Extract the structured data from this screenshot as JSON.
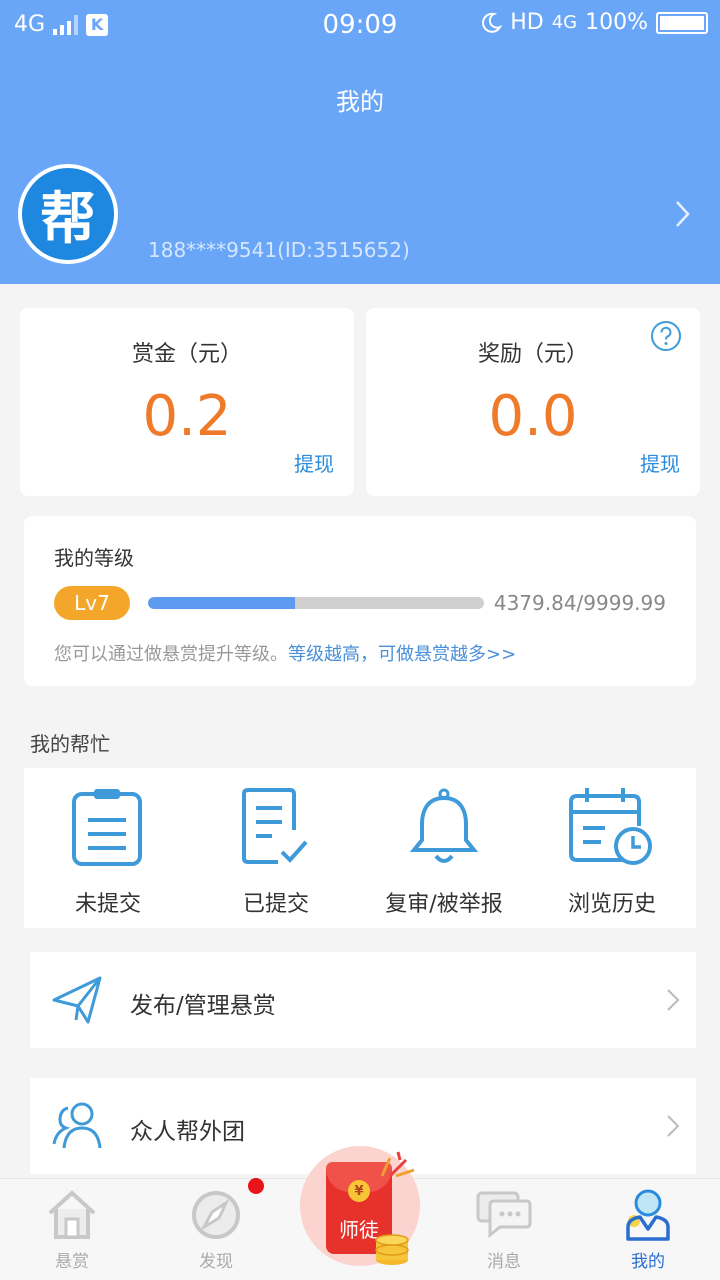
{
  "status_bar": {
    "network": "4G",
    "time": "09:09",
    "hd": "HD",
    "network_right": "4G",
    "battery": "100%"
  },
  "header": {
    "title": "我的",
    "avatar_text": "帮",
    "user_id": "188****9541(ID:3515652)"
  },
  "balance_cards": [
    {
      "title": "赏金（元）",
      "value": "0.2",
      "action": "提现"
    },
    {
      "title": "奖励（元）",
      "value": "0.0",
      "action": "提现"
    }
  ],
  "level": {
    "title": "我的等级",
    "badge": "Lv7",
    "progress_text": "4379.84/9999.99",
    "progress_fraction": 0.438,
    "tip": "您可以通过做悬赏提升等级。",
    "tip_link": "等级越高，可做悬赏越多>>"
  },
  "my_help": {
    "section_label": "我的帮忙",
    "items": [
      {
        "label": "未提交",
        "icon": "clipboard-icon"
      },
      {
        "label": "已提交",
        "icon": "document-check-icon"
      },
      {
        "label": "复审/被举报",
        "icon": "bell-icon"
      },
      {
        "label": "浏览历史",
        "icon": "calendar-clock-icon"
      }
    ]
  },
  "rows": [
    {
      "label": "发布/管理悬赏",
      "icon": "paper-plane-icon"
    },
    {
      "label": "众人帮外团",
      "icon": "users-icon"
    }
  ],
  "bottom_nav": {
    "items": [
      {
        "label": "悬赏",
        "icon": "home-icon",
        "active": false
      },
      {
        "label": "发现",
        "icon": "compass-icon",
        "active": false
      },
      {
        "label": "师徒",
        "icon": "red-packet-icon",
        "active": false
      },
      {
        "label": "消息",
        "icon": "chat-icon",
        "active": false
      },
      {
        "label": "我的",
        "icon": "profile-icon",
        "active": true
      }
    ]
  },
  "colors": {
    "header_bg": "#6aa6f8",
    "accent_orange": "#ef7a2a",
    "link_blue": "#2a8bde",
    "icon_blue": "#3e9ad8",
    "level_badge": "#f4a62a"
  }
}
